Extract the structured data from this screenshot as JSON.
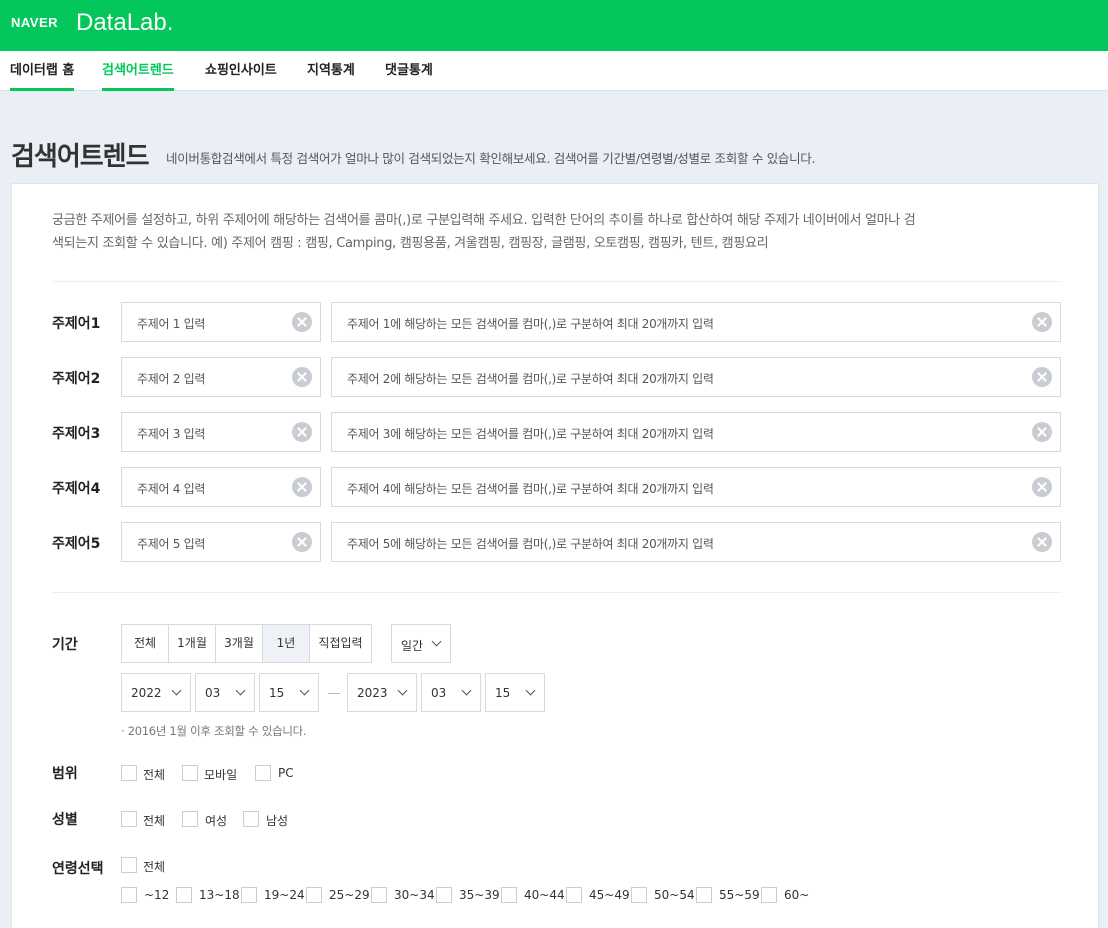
{
  "header": {
    "naver_logo": "NAVER",
    "app_name": "DataLab."
  },
  "nav": {
    "items": [
      {
        "label": "데이터랩 홈"
      },
      {
        "label": "검색어트렌드"
      },
      {
        "label": "쇼핑인사이트"
      },
      {
        "label": "지역통계"
      },
      {
        "label": "댓글통계"
      }
    ],
    "active_index": 1
  },
  "page": {
    "title": "검색어트렌드",
    "description": "네이버통합검색에서 특정 검색어가 얼마나 많이 검색되었는지 확인해보세요. 검색어를 기간별/연령별/성별로 조회할 수 있습니다."
  },
  "intro": {
    "line1": "궁금한 주제어를 설정하고, 하위 주제어에 해당하는 검색어를 콤마(,)로 구분입력해 주세요. 입력한 단어의 추이를 하나로 합산하여 해당 주제가 네이버에서 얼마나 검",
    "line2": "색되는지 조회할 수 있습니다. 예) 주제어 캠핑 : 캠핑, Camping, 캠핑용품, 겨울캠핑, 캠핑장, 글램핑, 오토캠핑, 캠핑카, 텐트, 캠핑요리"
  },
  "topics": [
    {
      "label": "주제어1",
      "name_placeholder": "주제어 1 입력",
      "keywords_placeholder": "주제어 1에 해당하는 모든 검색어를 컴마(,)로 구분하여 최대 20개까지 입력"
    },
    {
      "label": "주제어2",
      "name_placeholder": "주제어 2 입력",
      "keywords_placeholder": "주제어 2에 해당하는 모든 검색어를 컴마(,)로 구분하여 최대 20개까지 입력"
    },
    {
      "label": "주제어3",
      "name_placeholder": "주제어 3 입력",
      "keywords_placeholder": "주제어 3에 해당하는 모든 검색어를 컴마(,)로 구분하여 최대 20개까지 입력"
    },
    {
      "label": "주제어4",
      "name_placeholder": "주제어 4 입력",
      "keywords_placeholder": "주제어 4에 해당하는 모든 검색어를 컴마(,)로 구분하여 최대 20개까지 입력"
    },
    {
      "label": "주제어5",
      "name_placeholder": "주제어 5 입력",
      "keywords_placeholder": "주제어 5에 해당하는 모든 검색어를 컴마(,)로 구분하여 최대 20개까지 입력"
    }
  ],
  "period": {
    "label": "기간",
    "options": [
      "전체",
      "1개월",
      "3개월",
      "1년",
      "직접입력"
    ],
    "active": "1년",
    "interval": "일간",
    "start": {
      "year": "2022",
      "month": "03",
      "day": "15"
    },
    "end": {
      "year": "2023",
      "month": "03",
      "day": "15"
    },
    "note": "· 2016년 1월 이후 조회할 수 있습니다."
  },
  "scope": {
    "label": "범위",
    "options": [
      "전체",
      "모바일",
      "PC"
    ]
  },
  "gender": {
    "label": "성별",
    "options": [
      "전체",
      "여성",
      "남성"
    ]
  },
  "age": {
    "label": "연령선택",
    "all": "전체",
    "options": [
      "~12",
      "13~18",
      "19~24",
      "25~29",
      "30~34",
      "35~39",
      "40~44",
      "45~49",
      "50~54",
      "55~59",
      "60~"
    ]
  },
  "colors": {
    "brand": "#03c75a",
    "background": "#eaeef5"
  }
}
